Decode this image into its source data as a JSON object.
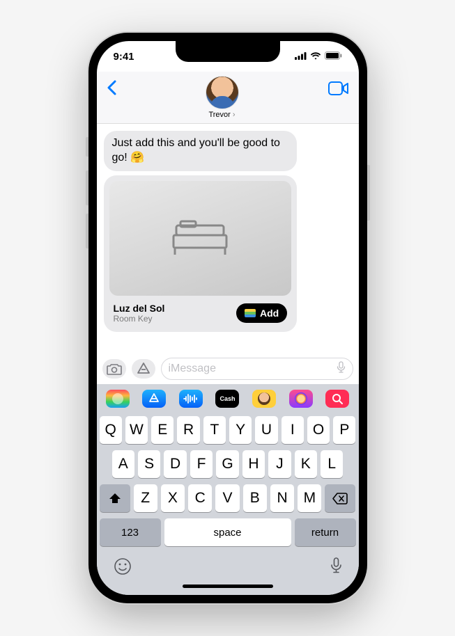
{
  "status": {
    "time": "9:41"
  },
  "contact": {
    "name": "Trevor"
  },
  "message": {
    "text": "Just add this and you'll be good to go! 🤗"
  },
  "card": {
    "title": "Luz del Sol",
    "subtitle": "Room Key",
    "action": "Add"
  },
  "compose": {
    "placeholder": "iMessage"
  },
  "keyboard": {
    "row1": [
      "Q",
      "W",
      "E",
      "R",
      "T",
      "Y",
      "U",
      "I",
      "O",
      "P"
    ],
    "row2": [
      "A",
      "S",
      "D",
      "F",
      "G",
      "H",
      "J",
      "K",
      "L"
    ],
    "row3": [
      "Z",
      "X",
      "C",
      "V",
      "B",
      "N",
      "M"
    ],
    "numKey": "123",
    "space": "space",
    "return": "return"
  },
  "appStrip": {
    "cashLabel": "Cash"
  }
}
